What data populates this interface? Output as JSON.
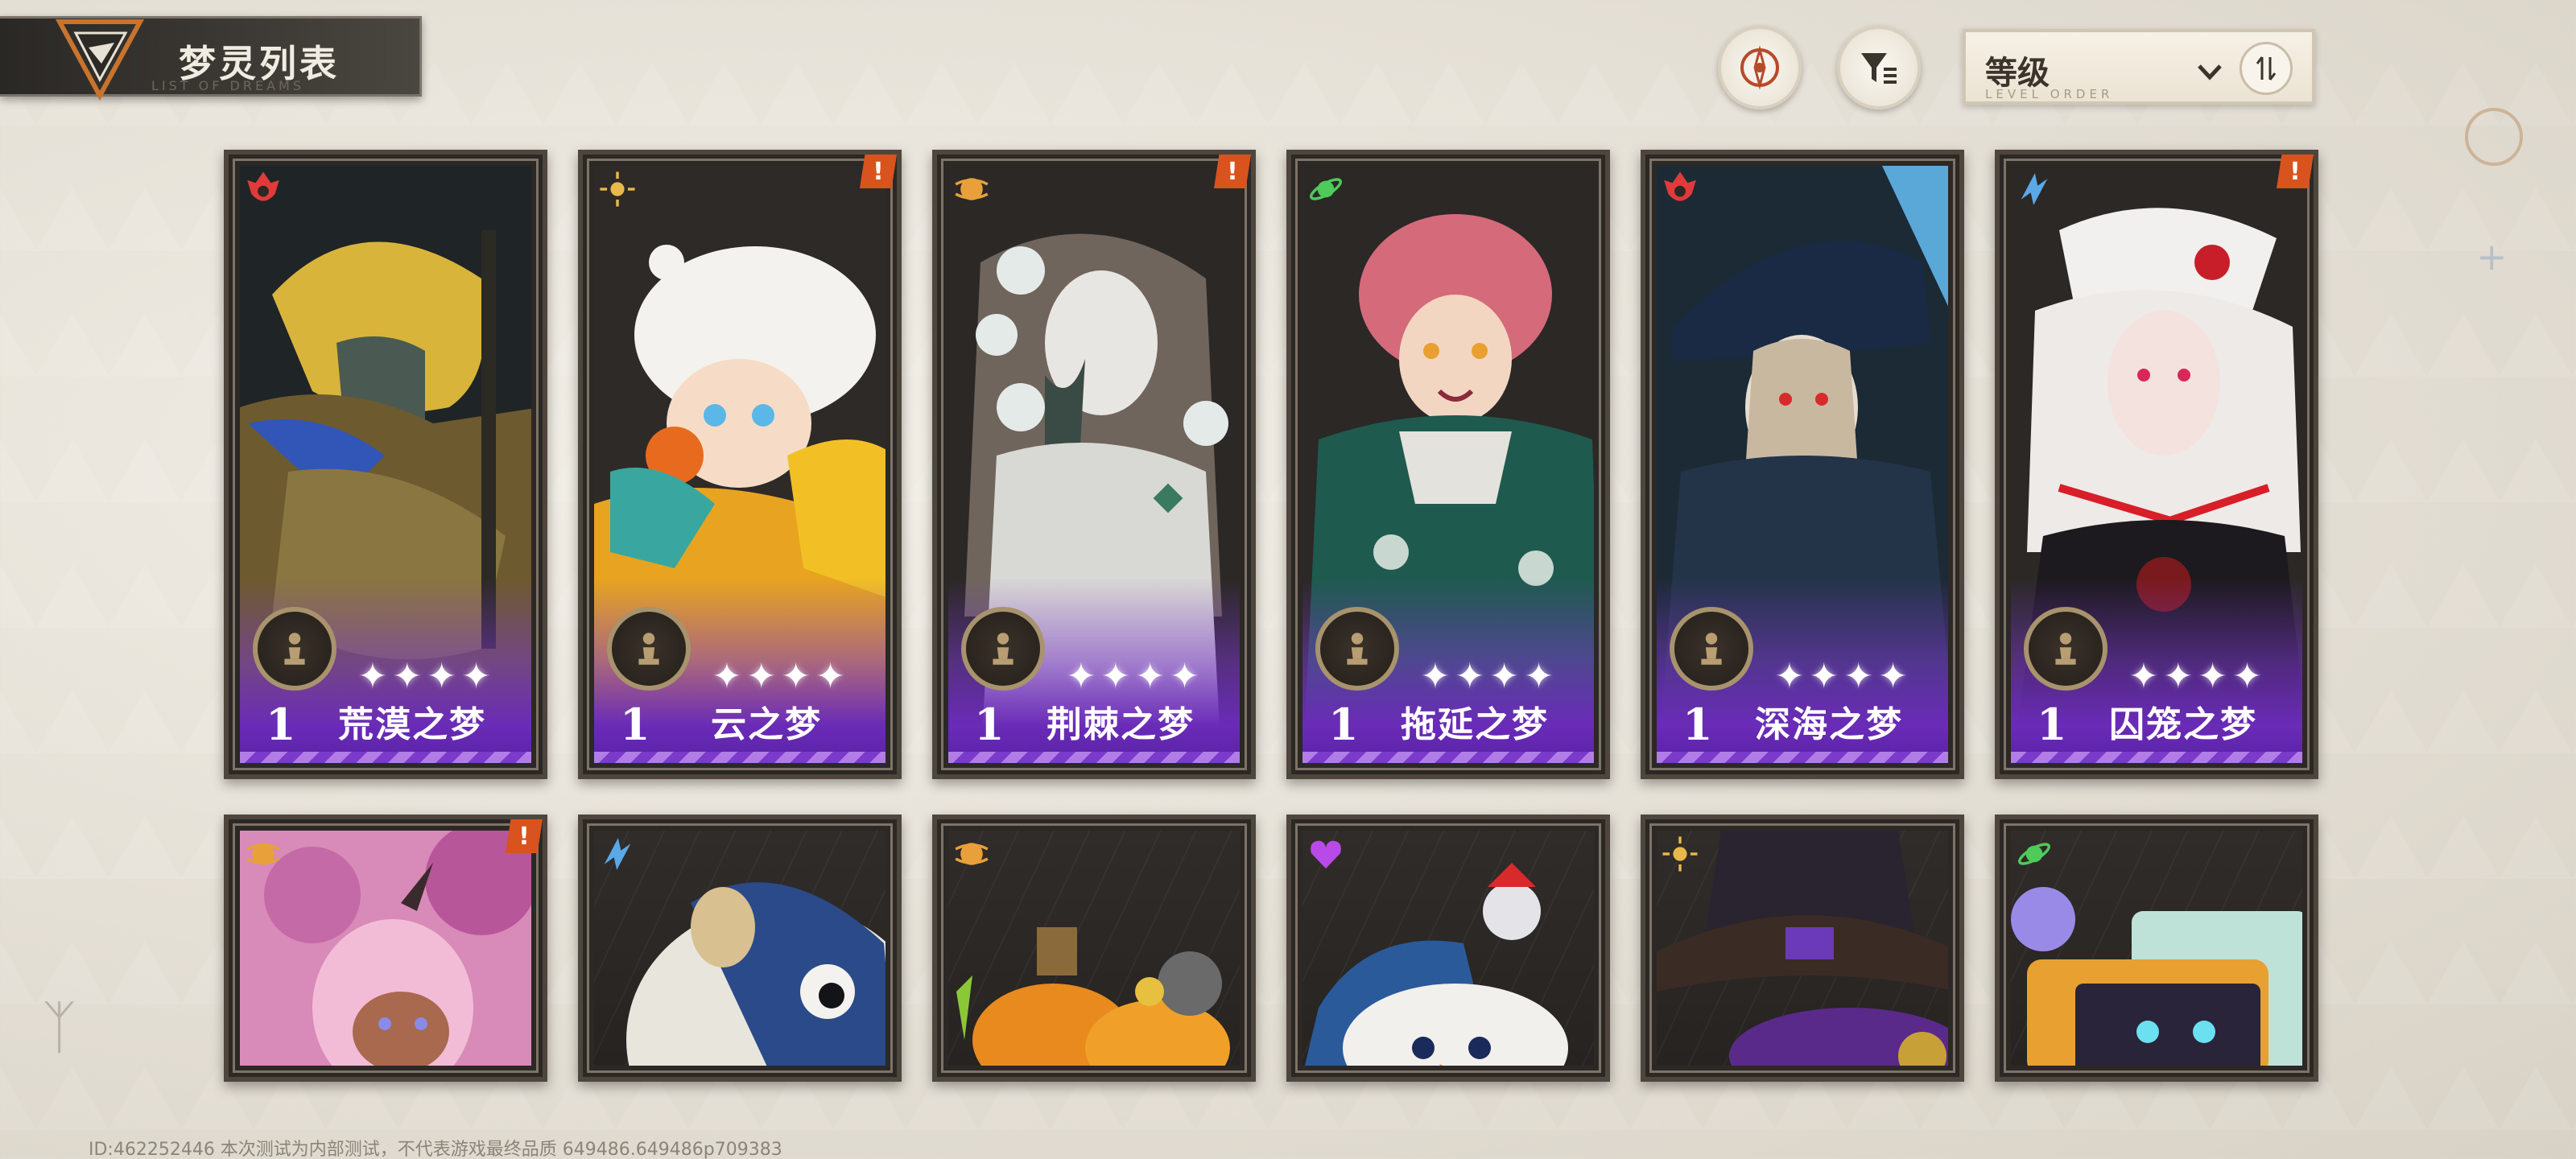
{
  "header": {
    "title": "梦灵列表",
    "subtitle": "LIST OF DREAMS",
    "sort": {
      "label": "等级",
      "sub_label": "LEVEL ORDER"
    }
  },
  "icons": {
    "logo": "triangle-logo-icon",
    "target": "target-icon",
    "filter": "filter-icon",
    "dropdown": "chevron-down-icon",
    "order": "sort-order-icon"
  },
  "cards_row1": [
    {
      "level": "1",
      "stars": "✦✦✦✦",
      "name": "荒漠之梦",
      "element": "red",
      "alert": ""
    },
    {
      "level": "1",
      "stars": "✦✦✦✦",
      "name": "云之梦",
      "element": "gold",
      "alert": "!"
    },
    {
      "level": "1",
      "stars": "✦✦✦✦",
      "name": "荆棘之梦",
      "element": "orange",
      "alert": "!"
    },
    {
      "level": "1",
      "stars": "✦✦✦✦",
      "name": "拖延之梦",
      "element": "green",
      "alert": ""
    },
    {
      "level": "1",
      "stars": "✦✦✦✦",
      "name": "深海之梦",
      "element": "red",
      "alert": ""
    },
    {
      "level": "1",
      "stars": "✦✦✦✦",
      "name": "囚笼之梦",
      "element": "blue",
      "alert": "!"
    }
  ],
  "cards_row2_alert": "!",
  "colors": {
    "rarity_purple": "#6a2bb8",
    "alert_orange": "#d9531e",
    "frame": "#4e463c"
  },
  "footer": {
    "id_text": "ID:462252446 本次测试为内部测试，不代表游戏最终品质 649486.649486p709383"
  }
}
